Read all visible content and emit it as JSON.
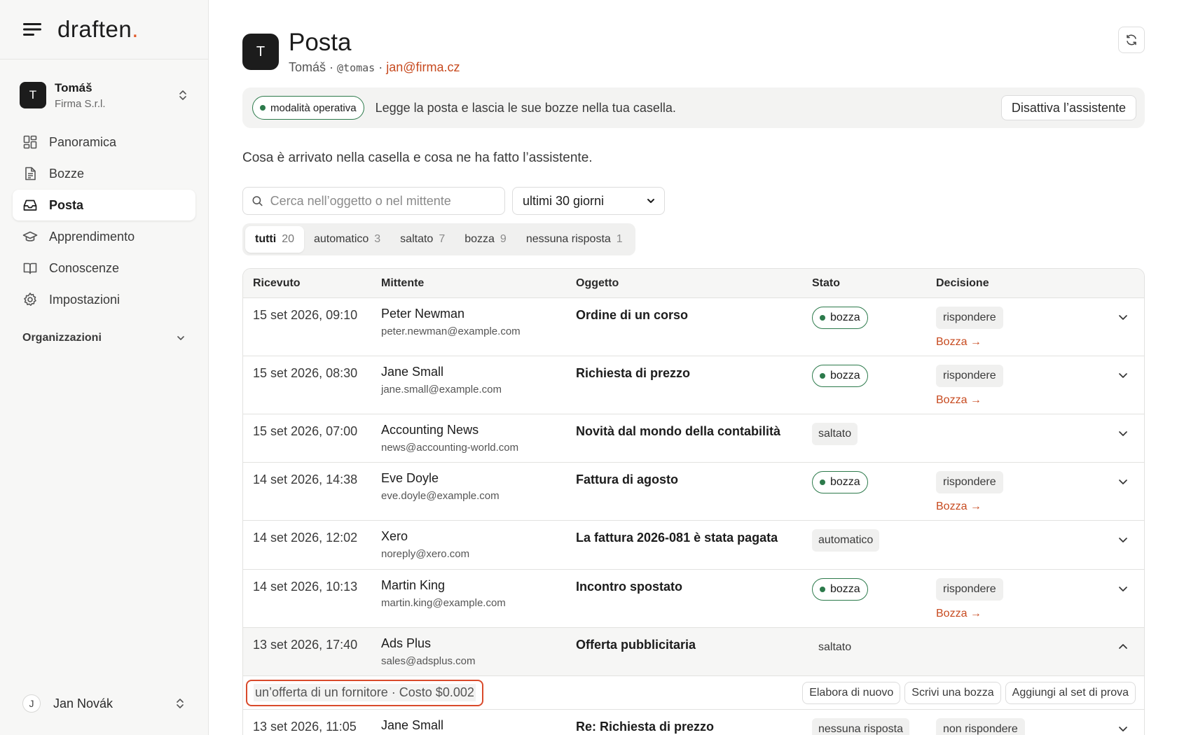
{
  "sidebar": {
    "logo": "draften",
    "logo_dot": ".",
    "workspace": {
      "avatar": "T",
      "name": "Tomáš",
      "org": "Firma S.r.l."
    },
    "nav": [
      {
        "label": "Panoramica",
        "icon": "dashboard-icon"
      },
      {
        "label": "Bozze",
        "icon": "document-icon"
      },
      {
        "label": "Posta",
        "icon": "inbox-icon",
        "active": true
      },
      {
        "label": "Apprendimento",
        "icon": "graduation-cap-icon"
      },
      {
        "label": "Conoscenze",
        "icon": "book-icon"
      },
      {
        "label": "Impostazioni",
        "icon": "gear-icon"
      }
    ],
    "section_label": "Organizzazioni",
    "user": {
      "avatar": "J",
      "name": "Jan Novák"
    }
  },
  "header": {
    "avatar": "T",
    "title": "Posta",
    "name": "Tomáš",
    "sep1": " · ",
    "handle": "@tomas",
    "sep2": " · ",
    "email": "jan@firma.cz"
  },
  "banner": {
    "mode_label": "modalità operativa",
    "text": "Legge la posta e lascia le sue bozze nella tua casella.",
    "disable_button": "Disattiva l’assistente"
  },
  "intro": "Cosa è arrivato nella casella e cosa ne ha fatto l’assistente.",
  "filters": {
    "search_placeholder": "Cerca nell’oggetto o nel mittente",
    "period": "ultimi 30 giorni",
    "tabs": [
      {
        "label": "tutti",
        "count": "20",
        "active": true
      },
      {
        "label": "automatico",
        "count": "3"
      },
      {
        "label": "saltato",
        "count": "7"
      },
      {
        "label": "bozza",
        "count": "9"
      },
      {
        "label": "nessuna risposta",
        "count": "1"
      }
    ]
  },
  "table": {
    "headers": [
      "Ricevuto",
      "Mittente",
      "Oggetto",
      "Stato",
      "Decisione"
    ],
    "rows": [
      {
        "received": "15 set 2026, 09:10",
        "sender": "Peter Newman",
        "email": "peter.newman@example.com",
        "subject": "Ordine di un corso",
        "status": "bozza",
        "decision": "rispondere",
        "link": "Bozza →"
      },
      {
        "received": "15 set 2026, 08:30",
        "sender": "Jane Small",
        "email": "jane.small@example.com",
        "subject": "Richiesta di prezzo",
        "status": "bozza",
        "decision": "rispondere",
        "link": "Bozza →"
      },
      {
        "received": "15 set 2026, 07:00",
        "sender": "Accounting News",
        "email": "news@accounting-world.com",
        "subject": "Novità dal mondo della contabilità",
        "status": "saltato",
        "decision": "",
        "link": ""
      },
      {
        "received": "14 set 2026, 14:38",
        "sender": "Eve Doyle",
        "email": "eve.doyle@example.com",
        "subject": "Fattura di agosto",
        "status": "bozza",
        "decision": "rispondere",
        "link": "Bozza →"
      },
      {
        "received": "14 set 2026, 12:02",
        "sender": "Xero",
        "email": "noreply@xero.com",
        "subject": "La fattura 2026-081 è stata pagata",
        "status": "automatico",
        "decision": "",
        "link": ""
      },
      {
        "received": "14 set 2026, 10:13",
        "sender": "Martin King",
        "email": "martin.king@example.com",
        "subject": "Incontro spostato",
        "status": "bozza",
        "decision": "rispondere",
        "link": "Bozza →"
      },
      {
        "received": "13 set 2026, 17:40",
        "sender": "Ads Plus",
        "email": "sales@adsplus.com",
        "subject": "Offerta pubblicitaria",
        "status": "saltato",
        "decision": "",
        "link": ""
      },
      {
        "received": "13 set 2026, 11:05",
        "sender": "Jane Small",
        "email": "",
        "subject": "Re: Richiesta di prezzo",
        "status": "nessuna risposta",
        "decision": "non rispondere",
        "link": ""
      }
    ],
    "expanded": {
      "note": "un’offerta di un fornitore · Costo $0.002",
      "actions": [
        "Elabora di nuovo",
        "Scrivi una bozza",
        "Aggiungi al set di prova"
      ]
    }
  },
  "colors": {
    "accent": "#c74a1f",
    "status_green": "#2c7a4b",
    "highlight_red": "#d94a2b"
  }
}
